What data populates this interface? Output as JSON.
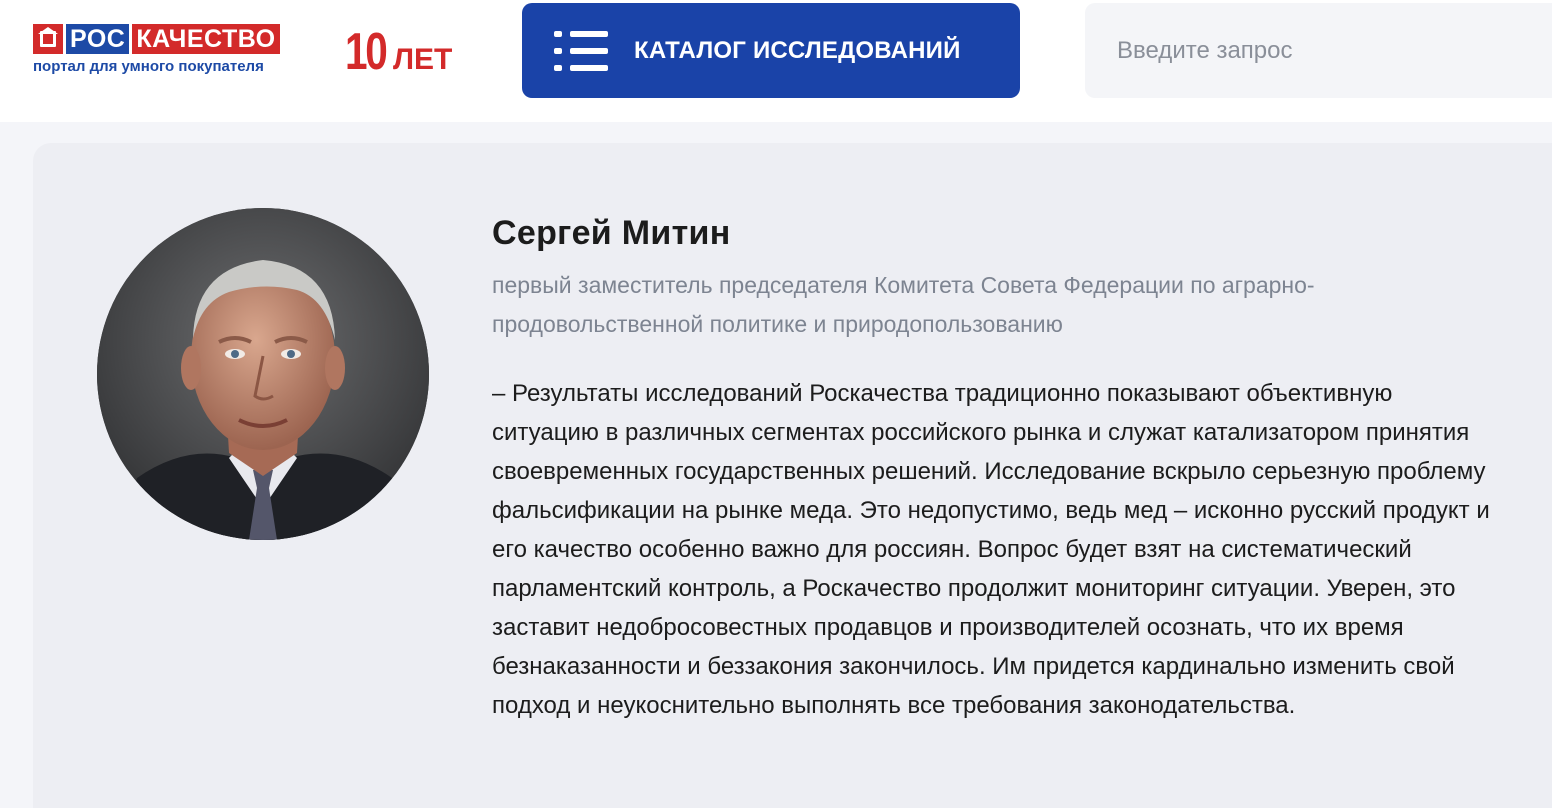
{
  "header": {
    "logo": {
      "ros": "РОС",
      "kachestvo": "КАЧЕСТВО",
      "subtitle": "портал для умного покупателя",
      "years_number": "10",
      "years_word": "ЛЕТ"
    },
    "catalog_button_label": "КАТАЛОГ ИССЛЕДОВАНИЙ",
    "search_placeholder": "Введите запрос"
  },
  "quote": {
    "name": "Сергей Митин",
    "position": "первый заместитель председателя Комитета Совета Федерации по аграрно-продовольственной политике и природопользованию",
    "text": "– Результаты исследований Роскачества традиционно показывают объективную ситуацию в различных сегментах российского рынка и служат катализатором принятия своевременных государственных решений. Исследование вскрыло серьезную проблему фальсификации на рынке меда. Это недопустимо, ведь мед – исконно русский продукт и его качество особенно важно для россиян. Вопрос будет взят на систематический парламентский контроль, а Роскачество продолжит мониторинг ситуации. Уверен, это заставит недобросовестных продавцов и производителей осознать, что их время безнаказанности и беззакония закончилось. Им придется кардинально изменить свой подход и неукоснительно выполнять все требования законодательства."
  },
  "colors": {
    "brand_blue": "#1a43a8",
    "brand_red": "#d32a2a",
    "card_bg": "#edeef3",
    "muted_text": "#7d8491"
  }
}
